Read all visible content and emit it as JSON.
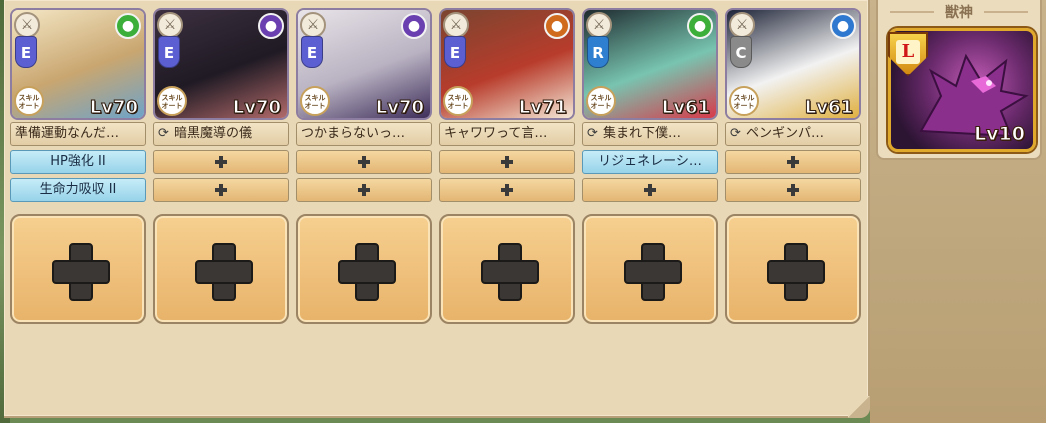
{
  "units": [
    {
      "rank": "E",
      "rank_color": "#5b5fd1",
      "class_icon": "swords-icon",
      "element": "wind",
      "element_color": "#3cae3a",
      "level": "Lv70",
      "skill_badge": "スキル\nオート",
      "skill_name": "準備運動なんだ…",
      "skill_cycle": false,
      "equip": [
        {
          "label": "HP強化 II",
          "filled": true
        },
        {
          "label": "生命力吸収 II",
          "filled": true
        }
      ],
      "portrait_colors": [
        "#f4e7c5",
        "#c9a670",
        "#6ea3c9"
      ]
    },
    {
      "rank": "E",
      "rank_color": "#5b5fd1",
      "class_icon": "staff-icon",
      "element": "dark",
      "element_color": "#6a3fb0",
      "level": "Lv70",
      "skill_badge": "スキル\nオート",
      "skill_name": "暗黒魔導の儀",
      "skill_cycle": true,
      "equip": [
        {
          "label": "",
          "filled": false
        },
        {
          "label": "",
          "filled": false
        }
      ],
      "portrait_colors": [
        "#3c3040",
        "#1f1a24",
        "#b26a6a"
      ]
    },
    {
      "rank": "E",
      "rank_color": "#5b5fd1",
      "class_icon": "swords-icon",
      "element": "dark",
      "element_color": "#6a3fb0",
      "level": "Lv70",
      "skill_badge": "スキル\nオート",
      "skill_name": "つかまらないっ…",
      "skill_cycle": false,
      "equip": [
        {
          "label": "",
          "filled": false
        },
        {
          "label": "",
          "filled": false
        }
      ],
      "portrait_colors": [
        "#e8e4e8",
        "#b9b2c2",
        "#3e2e5a"
      ]
    },
    {
      "rank": "E",
      "rank_color": "#5b5fd1",
      "class_icon": "wings-icon",
      "element": "fire",
      "element_color": "#d06a1d",
      "level": "Lv71",
      "skill_badge": "スキル\nオート",
      "skill_name": "キャワワって言…",
      "skill_cycle": false,
      "equip": [
        {
          "label": "",
          "filled": false
        },
        {
          "label": "",
          "filled": false
        }
      ],
      "portrait_colors": [
        "#7a4530",
        "#b83c2c",
        "#f4e7d6"
      ]
    },
    {
      "rank": "R",
      "rank_color": "#2e7fd0",
      "class_icon": "horn-icon",
      "element": "wind",
      "element_color": "#3cae3a",
      "level": "Lv61",
      "skill_badge": "スキル\nオート",
      "skill_name": "集まれ下僕…",
      "skill_cycle": true,
      "equip": [
        {
          "label": "リジェネレーシ…",
          "filled": true
        },
        {
          "label": "",
          "filled": false
        }
      ],
      "portrait_colors": [
        "#1e2a2e",
        "#78c4b0",
        "#d83a4a"
      ]
    },
    {
      "rank": "C",
      "rank_color": "#8a8a8a",
      "class_icon": "spiral-icon",
      "element": "water",
      "element_color": "#2e78d0",
      "level": "Lv61",
      "skill_badge": "スキル\nオート",
      "skill_name": "ペンギンパ…",
      "skill_cycle": true,
      "equip": [
        {
          "label": "",
          "filled": false
        },
        {
          "label": "",
          "filled": false
        }
      ],
      "portrait_colors": [
        "#1e2438",
        "#f2f2f2",
        "#e0b040"
      ]
    }
  ],
  "beast": {
    "title": "獣神",
    "rank": "L",
    "level": "Lv10",
    "icon": "dragon-icon"
  },
  "empty_slots": 6
}
